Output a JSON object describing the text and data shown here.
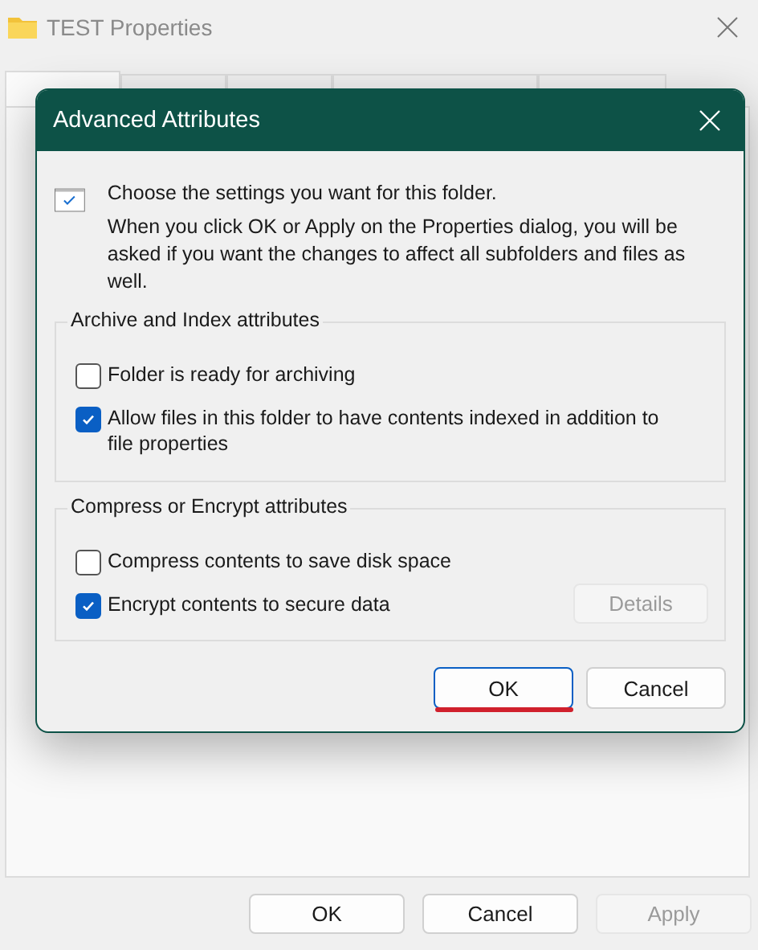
{
  "window": {
    "title": "TEST Properties"
  },
  "tabs": [
    {
      "selected": true
    },
    {
      "selected": false
    },
    {
      "selected": false
    },
    {
      "selected": false
    },
    {
      "selected": false
    }
  ],
  "dialog": {
    "title": "Advanced Attributes",
    "intro": "Choose the settings you want for this folder.",
    "note": "When you click OK or Apply on the Properties dialog, you will be asked if you want the changes to affect all subfolders and files as well.",
    "groups": [
      {
        "title": "Archive and Index attributes",
        "options": [
          {
            "label": "Folder is ready for archiving",
            "checked": false
          },
          {
            "label": "Allow files in this folder to have contents indexed in addition to file properties",
            "checked": true
          }
        ]
      },
      {
        "title": "Compress or Encrypt attributes",
        "options": [
          {
            "label": "Compress contents to save disk space",
            "checked": false
          },
          {
            "label": "Encrypt contents to secure data",
            "checked": true,
            "button": {
              "label": "Details",
              "disabled": true
            }
          }
        ]
      }
    ],
    "buttons": [
      {
        "label": "OK",
        "default": true
      },
      {
        "label": "Cancel",
        "default": false
      }
    ]
  },
  "buttons": [
    {
      "label": "OK",
      "disabled": false
    },
    {
      "label": "Cancel",
      "disabled": false
    },
    {
      "label": "Apply",
      "disabled": true
    }
  ]
}
